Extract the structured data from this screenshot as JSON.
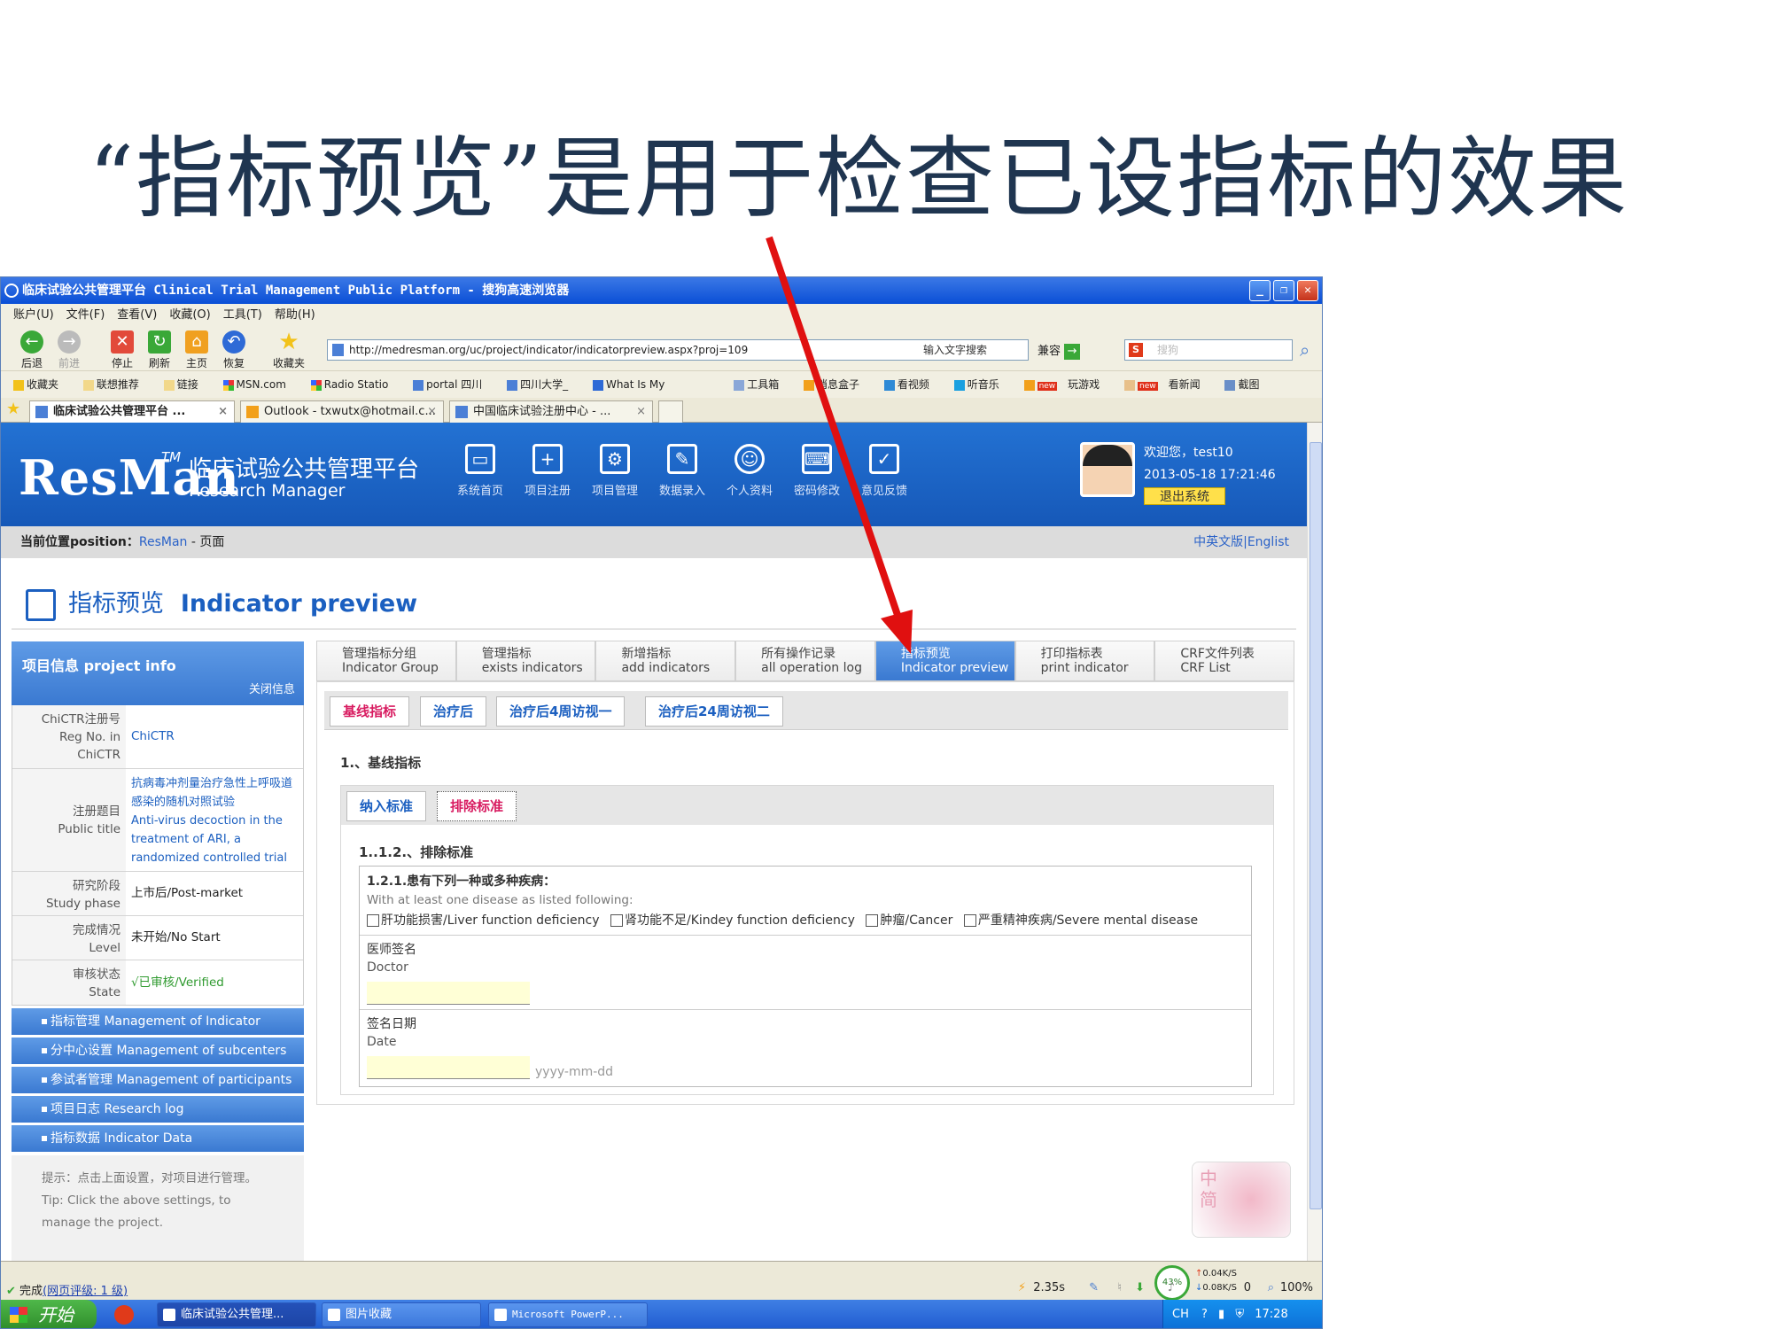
{
  "slide": {
    "title": "“指标预览”是用于检查已设指标的效果"
  },
  "browser": {
    "title": "临床试验公共管理平台 Clinical Trial Management Public Platform - 搜狗高速浏览器",
    "menu": [
      "账户(U)",
      "文件(F)",
      "查看(V)",
      "收藏(O)",
      "工具(T)",
      "帮助(H)"
    ],
    "toolbar": {
      "back": "后退",
      "forward": "前进",
      "stop": "停止",
      "refresh": "刷新",
      "home": "主页",
      "restore": "恢复",
      "favorites": "收藏夹"
    },
    "address": "http://medresman.org/uc/project/indicator/indicatorpreview.aspx?proj=109",
    "search_hint": "输入文字搜索",
    "compat": "兼容",
    "search_placeholder": "搜狗",
    "favbar": [
      "收藏夹",
      "联想推荐",
      "链接",
      "MSN.com",
      "Radio Statio",
      "portal 四川",
      "四川大学_",
      "What Is My"
    ],
    "favbar_right": [
      "工具箱",
      "消息盒子",
      "看视频",
      "听音乐",
      "玩游戏",
      "看新闻",
      "截图"
    ],
    "favbar_new": "new",
    "tabs": [
      "临床试验公共管理平台 ...",
      "Outlook - txwutx@hotmail.c...",
      "中国临床试验注册中心 - ..."
    ],
    "close_glyph": "×"
  },
  "site": {
    "brand": "ResMan",
    "brand_tm": "TM",
    "brand_cn": "临床试验公共管理平台",
    "brand_en": "Research Manager",
    "nav": [
      "系统首页",
      "项目注册",
      "项目管理",
      "数据录入",
      "个人资料",
      "密码修改",
      "意见反馈"
    ],
    "welcome": "欢迎您，test10",
    "datetime": "2013-05-18 17:21:46",
    "logout": "退出系统",
    "crumb_label": "当前位置position：",
    "crumb_link": "ResMan",
    "crumb_rest": " - 页面",
    "lang": "中英文版|Englist",
    "page_title_cn": "指标预览",
    "page_title_en": "Indicator preview"
  },
  "side": {
    "head": "项目信息  project info",
    "close": "关闭信息",
    "rows": [
      {
        "key": "ChiCTR注册号\nReg No. in ChiCTR",
        "value": "ChiCTR"
      },
      {
        "key": "注册题目\nPublic title",
        "value": "抗病毒冲剂量治疗急性上呼吸道感染的随机对照试验\nAnti-virus decoction in the treatment of ARI, a randomized controlled trial"
      },
      {
        "key": "研究阶段\nStudy phase",
        "value": "上市后/Post-market"
      },
      {
        "key": "完成情况\nLevel",
        "value": "未开始/No Start"
      },
      {
        "key": "审核状态\nState",
        "value": "√已审核/Verified"
      }
    ],
    "buttons": [
      "指标管理  Management of Indicator",
      "分中心设置  Management of subcenters",
      "参试者管理  Management of participants",
      "项目日志  Research log",
      "指标数据  Indicator Data"
    ],
    "tip": "提示：点击上面设置，对项目进行管理。\nTip: Click the above settings, to manage the project."
  },
  "main": {
    "tabs": [
      {
        "cn": "管理指标分组",
        "en": "Indicator Group"
      },
      {
        "cn": "管理指标",
        "en": "exists indicators"
      },
      {
        "cn": "新增指标",
        "en": "add indicators"
      },
      {
        "cn": "所有操作记录",
        "en": "all operation log"
      },
      {
        "cn": "指标预览",
        "en": "Indicator preview"
      },
      {
        "cn": "打印指标表",
        "en": "print indicator"
      },
      {
        "cn": "CRF文件列表",
        "en": "CRF List"
      }
    ],
    "subtabs": [
      "基线指标",
      "治疗后",
      "治疗后4周访视一",
      "治疗后24周访视二"
    ],
    "section_title": "1.、基线指标",
    "inner_tabs": [
      "纳入标准",
      "排除标准"
    ],
    "sub_section": "1..1.2.、排除标准",
    "question": "1.2.1.患有下列一种或多种疾病：",
    "question_en": "With at least one disease as listed following:",
    "options": [
      "肝功能损害/Liver function deficiency",
      "肾功能不足/Kindey function deficiency",
      "肿瘤/Cancer",
      "严重精神疾病/Severe mental disease"
    ],
    "doctor_cn": "医师签名",
    "doctor_en": "Doctor",
    "date_cn": "签名日期",
    "date_en": "Date",
    "date_format": "yyyy-mm-dd",
    "rose_text": "中\n简"
  },
  "status": {
    "done": "完成",
    "rating": "(网页评级: 1 级)",
    "speed": "2.35s",
    "zoom": "100%",
    "gauge": "43%",
    "up": "0.04K/S",
    "down": "0.08K/S",
    "zero": "0"
  },
  "taskbar": {
    "start": "开始",
    "tasks": [
      "临床试验公共管理...",
      "图片收藏",
      "Microsoft PowerP..."
    ],
    "tray_lang": "CH",
    "time": "17:28"
  },
  "colors": {
    "title": "#1f3550",
    "header_blue": "#1658b8",
    "arrow_red": "#e01010",
    "active_tab": "#3a79d1",
    "pink": "#d81b60"
  }
}
